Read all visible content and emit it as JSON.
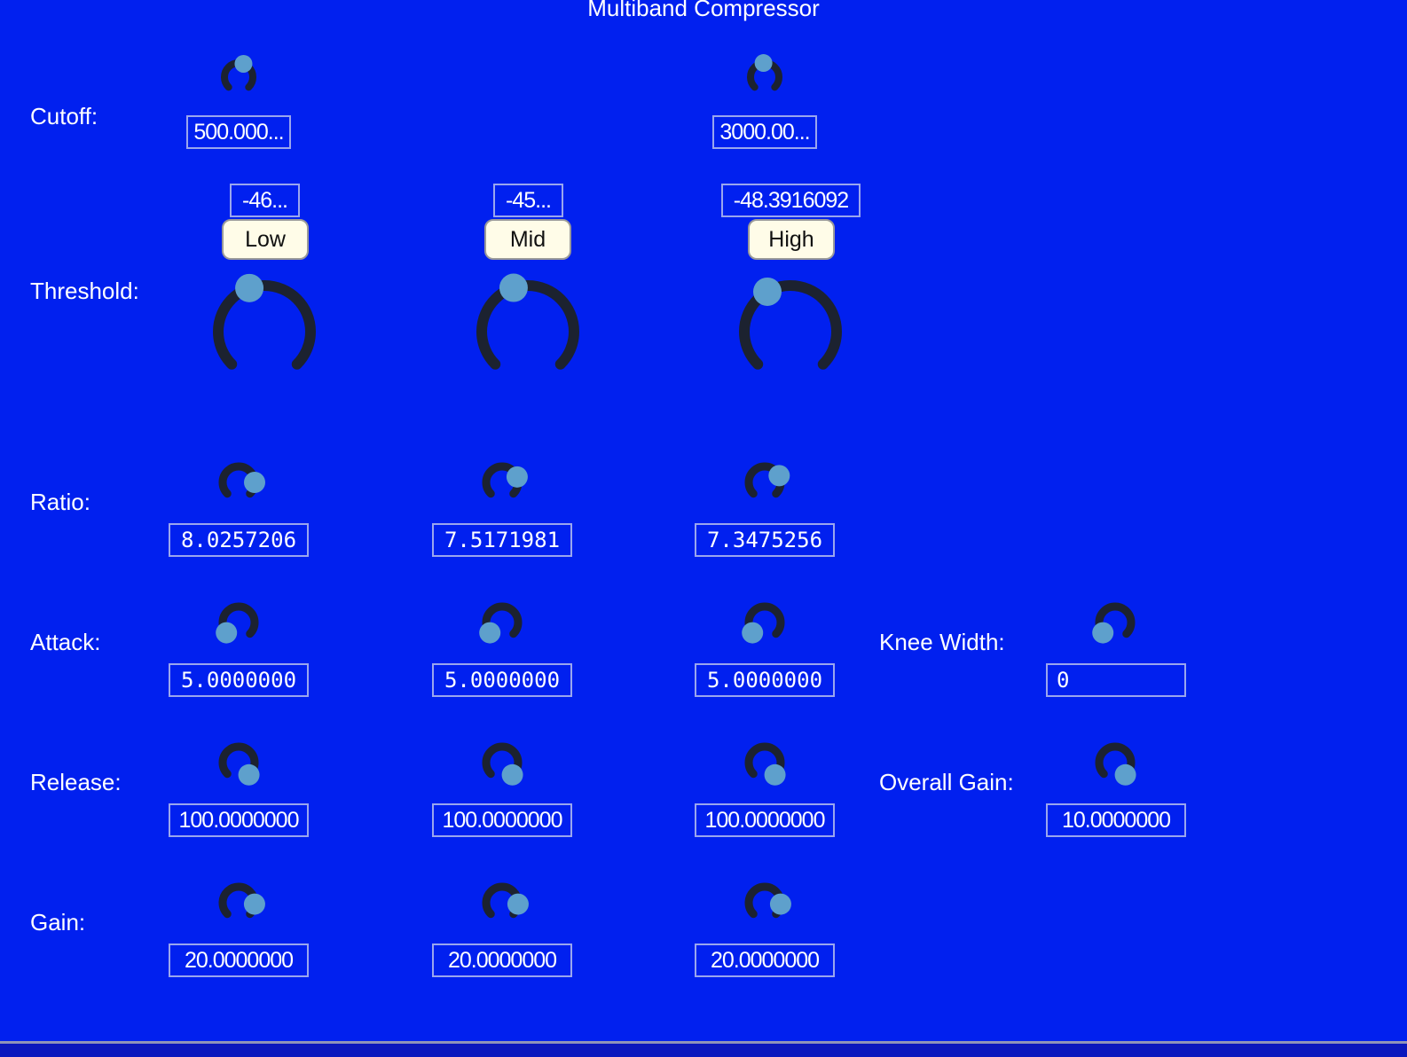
{
  "title": "Multiband Compressor",
  "colors": {
    "background": "#0120ef",
    "knob_track": "#1c2230",
    "knob_handle": "#5ea0cc",
    "button_bg": "#fffce8"
  },
  "labels": {
    "cutoff": "Cutoff:",
    "threshold": "Threshold:",
    "ratio": "Ratio:",
    "attack": "Attack:",
    "release": "Release:",
    "gain": "Gain:",
    "knee_width": "Knee Width:",
    "overall_gain": "Overall Gain:"
  },
  "bands": [
    "Low",
    "Mid",
    "High"
  ],
  "cutoff": {
    "low": "500.000...",
    "high": "3000.00..."
  },
  "threshold": {
    "low": "-46...",
    "mid": "-45...",
    "high": "-48.3916092"
  },
  "ratio": {
    "low": "8.0257206",
    "mid": "7.5171981",
    "high": "7.3475256"
  },
  "attack": {
    "low": "5.0000000",
    "mid": "5.0000000",
    "high": "5.0000000"
  },
  "release": {
    "low": "100.0000000",
    "mid": "100.0000000",
    "high": "100.0000000"
  },
  "gain": {
    "low": "20.0000000",
    "mid": "20.0000000",
    "high": "20.0000000"
  },
  "knee_width": "0",
  "overall_gain": "10.0000000"
}
